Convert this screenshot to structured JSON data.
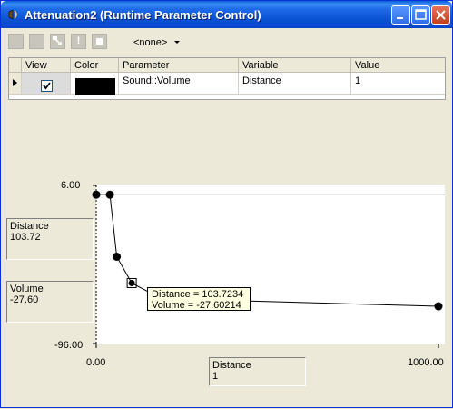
{
  "window": {
    "title": "Attenuation2 (Runtime Parameter Control)"
  },
  "toolbar": {
    "buttons": [
      "new-icon",
      "delete-icon",
      "edit-icon",
      "exclamation-icon",
      "stop-icon"
    ],
    "exclamation_glyph": "!",
    "dropdown_value": "<none>"
  },
  "grid": {
    "headers": [
      "View",
      "Color",
      "Parameter",
      "Variable",
      "Value"
    ],
    "row": {
      "view_checked": true,
      "color": "#000000",
      "parameter": "Sound::Volume",
      "variable": "Distance",
      "value": "1"
    }
  },
  "graph": {
    "y_axis": {
      "top_label": "6.00",
      "bottom_label": "-96.00"
    },
    "x_axis": {
      "left_label": "0.00",
      "right_label": "1000.00"
    },
    "x_readout": {
      "label": "Distance",
      "value": "103.72"
    },
    "y_readout": {
      "label": "Volume",
      "value": "-27.60"
    },
    "bottom_readout": {
      "label": "Distance",
      "value": "1"
    },
    "tooltip": {
      "line1": "Distance = 103.7234",
      "line2": "Volume = -27.60214"
    }
  },
  "chart_data": {
    "type": "line",
    "xlim": [
      0,
      1000
    ],
    "ylim": [
      -96,
      6
    ],
    "points": [
      {
        "x": 0,
        "y": 0
      },
      {
        "x": 40,
        "y": 0
      },
      {
        "x": 60,
        "y": -40
      },
      {
        "x": 103.72,
        "y": -57
      },
      {
        "x": 190,
        "y": -67
      },
      {
        "x": 1000,
        "y": -72
      }
    ],
    "selected_index": 3,
    "reference_y": 0,
    "color": "#000000"
  }
}
